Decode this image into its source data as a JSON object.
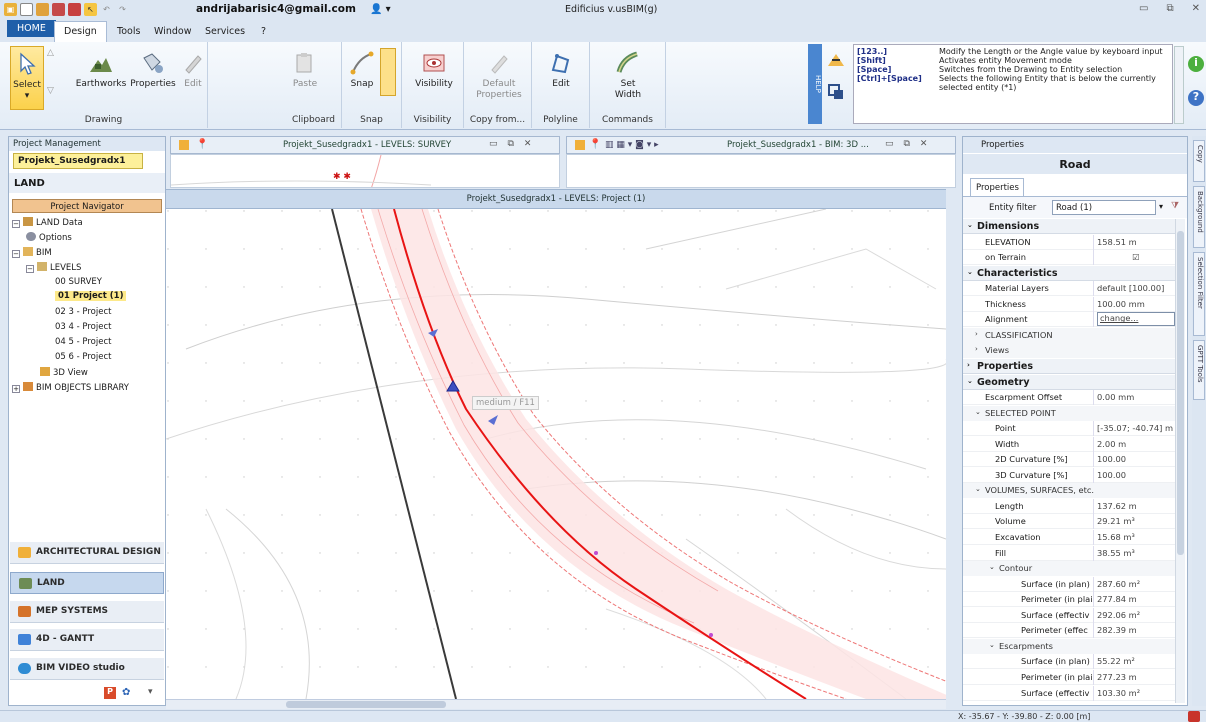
{
  "titlebar": {
    "email": "andrijabarisic4@gmail.com",
    "app_title": "Edificius v.usBIM(g)"
  },
  "menu": {
    "tabs": [
      "HOME",
      "Design",
      "Tools",
      "Window",
      "Services",
      "?"
    ]
  },
  "ribbon": {
    "select": "Select",
    "earthworks": "Earthworks",
    "properties": "Properties",
    "edit": "Edit",
    "drawing_group": "Drawing",
    "paste": "Paste",
    "clipboard_group": "Clipboard",
    "snap": "Snap",
    "snap_group": "Snap",
    "visibility": "Visibility",
    "visibility_group": "Visibility",
    "default_properties_1": "Default",
    "default_properties_2": "Properties",
    "copy_from_group": "Copy from...",
    "polyline_edit": "Edit",
    "polyline_group": "Polyline",
    "set_width_1": "Set",
    "set_width_2": "Width",
    "commands_group": "Commands",
    "help_strip": "HELP",
    "help": [
      {
        "key": "[123..]",
        "text": "Modify the Length or the Angle value by keyboard input"
      },
      {
        "key": "[Shift]",
        "text": "Activates entity Movement mode"
      },
      {
        "key": "[Space]",
        "text": "Switches from the Drawing to Entity selection"
      },
      {
        "key": "[Ctrl]+[Space]",
        "text": "Selects the following Entity that is below the currently"
      },
      {
        "key": "",
        "text": "selected entity (*1)"
      }
    ]
  },
  "left_panel": {
    "header": "Project Management",
    "project_name": "Projekt_Susedgradx1",
    "land_label": "LAND",
    "navigator_button": "Project Navigator",
    "tree": [
      {
        "label": "LAND Data"
      },
      {
        "label": "Options"
      },
      {
        "label": "BIM"
      },
      {
        "label": "LEVELS"
      },
      {
        "label": "00 SURVEY"
      },
      {
        "label": "01 Project (1)"
      },
      {
        "label": "02 3 - Project"
      },
      {
        "label": "03 4 - Project"
      },
      {
        "label": "04 5 - Project"
      },
      {
        "label": "05 6 - Project"
      },
      {
        "label": "3D View"
      },
      {
        "label": "BIM OBJECTS LIBRARY"
      }
    ]
  },
  "modules": [
    "ARCHITECTURAL DESIGN",
    "LAND",
    "MEP SYSTEMS",
    "4D - GANTT",
    "BIM VIDEO studio"
  ],
  "viewports": {
    "top1_title": "Projekt_Susedgradx1 - LEVELS: SURVEY",
    "top2_title": "Projekt_Susedgradx1 - BIM: 3D ...",
    "main_title": "Projekt_Susedgradx1 - LEVELS: Project (1)",
    "cursor_label": "medium / F11"
  },
  "properties": {
    "header": "Properties",
    "title": "Road",
    "tab": "Properties",
    "entity_filter_label": "Entity filter",
    "entity_filter_value": "Road (1)",
    "rows": [
      {
        "type": "sec",
        "name": "Dimensions",
        "value": ""
      },
      {
        "type": "leaf",
        "name": "ELEVATION",
        "value": "158.51 m"
      },
      {
        "type": "leaf",
        "name": "on Terrain",
        "value": "☑"
      },
      {
        "type": "sec",
        "name": "Characteristics",
        "value": ""
      },
      {
        "type": "leaf",
        "name": "Material Layers",
        "value": "default [100.00]"
      },
      {
        "type": "leaf",
        "name": "Thickness",
        "value": "100.00 mm"
      },
      {
        "type": "leaf",
        "name": "Alignment",
        "value": "change..."
      },
      {
        "type": "sub",
        "name": "CLASSIFICATION",
        "value": ""
      },
      {
        "type": "sub",
        "name": "Views",
        "value": ""
      },
      {
        "type": "sec",
        "name": "Properties",
        "value": ""
      },
      {
        "type": "sec",
        "name": "Geometry",
        "value": ""
      },
      {
        "type": "leaf",
        "name": "Escarpment Offset",
        "value": "0.00 mm"
      },
      {
        "type": "sub",
        "name": "SELECTED POINT",
        "value": ""
      },
      {
        "type": "leaf2",
        "name": "Point",
        "value": "[-35.07; -40.74] m"
      },
      {
        "type": "leaf2",
        "name": "Width",
        "value": "2.00 m"
      },
      {
        "type": "leaf2",
        "name": "2D Curvature [%]",
        "value": "100.00"
      },
      {
        "type": "leaf2",
        "name": "3D Curvature [%]",
        "value": "100.00"
      },
      {
        "type": "sub",
        "name": "VOLUMES, SURFACES, etc.",
        "value": ""
      },
      {
        "type": "leaf2",
        "name": "Length",
        "value": "137.62 m"
      },
      {
        "type": "leaf2",
        "name": "Volume",
        "value": "29.21 m³"
      },
      {
        "type": "leaf2",
        "name": "Excavation",
        "value": "15.68 m³"
      },
      {
        "type": "leaf2",
        "name": "Fill",
        "value": "38.55 m³"
      },
      {
        "type": "sub2",
        "name": "Contour",
        "value": ""
      },
      {
        "type": "leaf3",
        "name": "Surface (in plan)",
        "value": "287.60 m²"
      },
      {
        "type": "leaf3",
        "name": "Perimeter (in plai",
        "value": "277.84 m"
      },
      {
        "type": "leaf3",
        "name": "Surface (effectiv",
        "value": "292.06 m²"
      },
      {
        "type": "leaf3",
        "name": "Perimeter (effec",
        "value": "282.39 m"
      },
      {
        "type": "sub2",
        "name": "Escarpments",
        "value": ""
      },
      {
        "type": "leaf3",
        "name": "Surface (in plan)",
        "value": "55.22 m²"
      },
      {
        "type": "leaf3",
        "name": "Perimeter (in plai",
        "value": "277.23 m"
      },
      {
        "type": "leaf3",
        "name": "Surface (effectiv",
        "value": "103.30 m²"
      }
    ]
  },
  "side_tabs": [
    "Copy",
    "Background",
    "Selection Filter",
    "GPTT Tools"
  ],
  "status": {
    "coords": "X: -35.67 - Y: -39.80 - Z: 0.00 [m]"
  }
}
